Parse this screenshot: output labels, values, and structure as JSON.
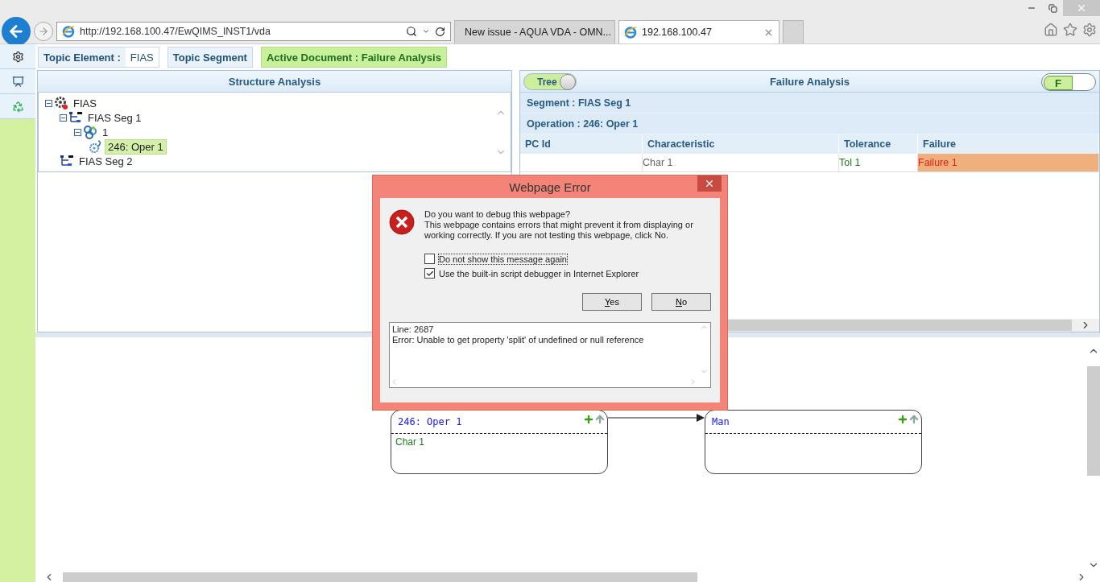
{
  "browser": {
    "address": "http://192.168.100.47/EwQIMS_INST1/vda",
    "tabs": [
      {
        "title": "New issue - AQUA VDA - OMN...",
        "kind": "issue",
        "selected": false
      },
      {
        "title": "192.168.100.47",
        "kind": "ie",
        "selected": true
      }
    ]
  },
  "topic_bar": [
    {
      "label": "Topic Element :",
      "value": "FIAS",
      "kind": "plain"
    },
    {
      "label": "Topic Segment",
      "kind": "plain"
    },
    {
      "label": "Active Document : Failure Analysis",
      "kind": "active"
    }
  ],
  "structure_analysis": {
    "title": "Structure Analysis",
    "tree": [
      {
        "label": "FIAS",
        "kind": "element",
        "selected": false,
        "expanded": true,
        "children": [
          {
            "label": "FIAS Seg 1",
            "kind": "segment",
            "selected": false,
            "expanded": true,
            "children": [
              {
                "label": "1",
                "kind": "group",
                "selected": false,
                "expanded": true,
                "children": [
                  {
                    "label": "246: Oper 1",
                    "kind": "operation",
                    "selected": true
                  }
                ]
              }
            ]
          },
          {
            "label": "FIAS Seg 2",
            "kind": "segment",
            "selected": false
          }
        ]
      }
    ]
  },
  "failure_analysis": {
    "title": "Failure Analysis",
    "tree_toggle": {
      "label": "Tree",
      "on": true
    },
    "mode_toggle": {
      "label": "F",
      "on": true
    },
    "segment": "Segment : FIAS Seg 1",
    "operation": "Operation : 246: Oper 1",
    "table": {
      "columns": [
        "PC Id",
        "Characteristic",
        "Tolerance",
        "Failure"
      ],
      "rows": [
        {
          "characteristic": "Char 1",
          "tolerance": "Tol 1",
          "failure": "Failure 1"
        }
      ]
    }
  },
  "diagram": {
    "nodes": [
      {
        "title": "246: Oper 1",
        "items": [
          "Char 1"
        ]
      },
      {
        "title": "Man"
      }
    ]
  },
  "dialog": {
    "title": "Webpage Error",
    "question": "Do you want to debug this webpage?",
    "message": "This webpage contains errors that might prevent it from displaying or working correctly. If you are not testing this webpage, click No.",
    "options": [
      {
        "label": "Do not show this message again",
        "checked": false
      },
      {
        "label": "Use the built-in script debugger in Internet Explorer",
        "checked": true
      }
    ],
    "buttons": [
      "Yes",
      "No"
    ],
    "details": [
      "Line: 2687",
      "Error: Unable to get property 'split' of undefined or null reference"
    ]
  }
}
